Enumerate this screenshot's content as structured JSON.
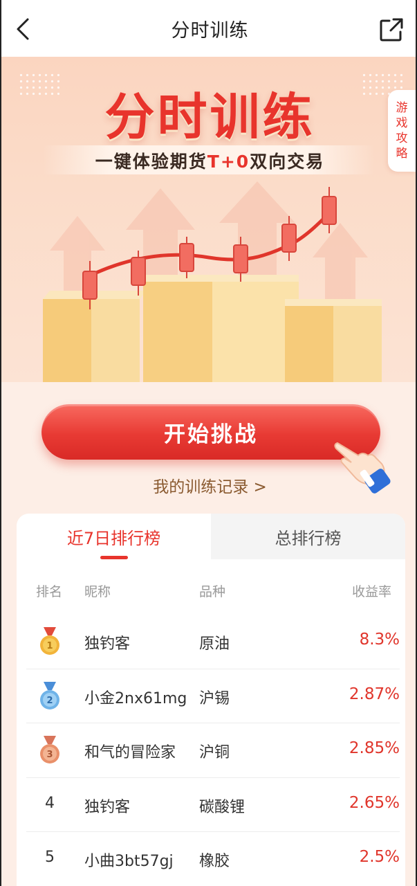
{
  "nav": {
    "title": "分时训练",
    "back_icon": "chevron-left-icon",
    "share_icon": "share-external-icon"
  },
  "hero": {
    "title": "分时训练",
    "subtitle_prefix": "一键体验期货",
    "subtitle_highlight": "T+0",
    "subtitle_suffix": "双向交易",
    "strategy_tab": [
      "游",
      "戏",
      "攻",
      "略"
    ]
  },
  "actions": {
    "start_label": "开始挑战",
    "record_label": "我的训练记录 >"
  },
  "ranking": {
    "tabs": [
      {
        "label": "近7日排行榜",
        "active": true
      },
      {
        "label": "总排行榜",
        "active": false
      }
    ],
    "columns": {
      "rank": "排名",
      "nickname": "昵称",
      "variety": "品种",
      "yield": "收益率"
    },
    "rows": [
      {
        "rank": "1",
        "medal": "gold",
        "nickname": "独钓客",
        "variety": "原油",
        "yield": "8.3%"
      },
      {
        "rank": "2",
        "medal": "silver",
        "nickname": "小金2nx61mg",
        "variety": "沪锡",
        "yield": "2.87%"
      },
      {
        "rank": "3",
        "medal": "bronze",
        "nickname": "和气的冒险家",
        "variety": "沪铜",
        "yield": "2.85%"
      },
      {
        "rank": "4",
        "medal": "",
        "nickname": "独钓客",
        "variety": "碳酸锂",
        "yield": "2.65%"
      },
      {
        "rank": "5",
        "medal": "",
        "nickname": "小曲3bt57gj",
        "variety": "橡胶",
        "yield": "2.5%"
      }
    ]
  },
  "colors": {
    "accent": "#e8342c",
    "gold": "#f2b43a",
    "silver": "#6fb3e8",
    "bronze": "#e9906a"
  }
}
